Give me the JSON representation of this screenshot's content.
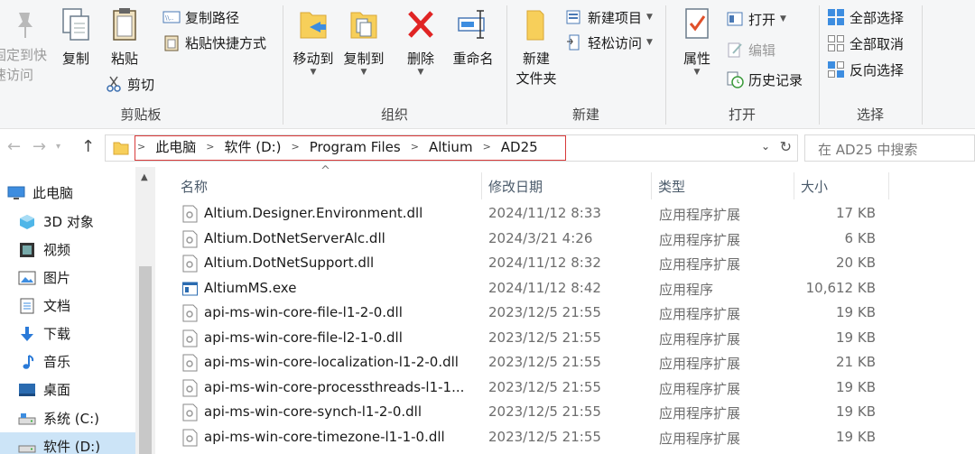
{
  "ribbon": {
    "clipboard": {
      "label": "剪贴板",
      "pin_label_1": "固定到快",
      "pin_label_2": "速访问",
      "copy": "复制",
      "paste": "粘贴",
      "copy_path": "复制路径",
      "paste_shortcut": "粘贴快捷方式",
      "cut": "剪切"
    },
    "organize": {
      "label": "组织",
      "move_to": "移动到",
      "copy_to": "复制到",
      "delete": "删除",
      "rename": "重命名"
    },
    "new": {
      "label": "新建",
      "new_folder_1": "新建",
      "new_folder_2": "文件夹",
      "new_item": "新建项目",
      "easy_access": "轻松访问"
    },
    "open": {
      "label": "打开",
      "properties": "属性",
      "open": "打开",
      "edit": "编辑",
      "history": "历史记录"
    },
    "select": {
      "label": "选择",
      "select_all": "全部选择",
      "select_none": "全部取消",
      "invert": "反向选择"
    }
  },
  "address": {
    "crumbs": [
      "此电脑",
      "软件 (D:)",
      "Program Files",
      "Altium",
      "AD25"
    ],
    "search_placeholder": "在 AD25 中搜索"
  },
  "nav": {
    "items": [
      {
        "label": "此电脑",
        "icon": "pc-icon"
      },
      {
        "label": "3D 对象",
        "icon": "3d-objects-icon"
      },
      {
        "label": "视频",
        "icon": "video-icon"
      },
      {
        "label": "图片",
        "icon": "pictures-icon"
      },
      {
        "label": "文档",
        "icon": "documents-icon"
      },
      {
        "label": "下载",
        "icon": "download-icon"
      },
      {
        "label": "音乐",
        "icon": "music-icon"
      },
      {
        "label": "桌面",
        "icon": "desktop-icon"
      },
      {
        "label": "系统 (C:)",
        "icon": "drive-icon"
      },
      {
        "label": "软件 (D:)",
        "icon": "drive-icon"
      }
    ]
  },
  "columns": {
    "name": "名称",
    "date": "修改日期",
    "type": "类型",
    "size": "大小"
  },
  "files": [
    {
      "name": "Altium.Designer.Environment.dll",
      "date": "2024/11/12 8:33",
      "type": "应用程序扩展",
      "size": "17 KB",
      "kind": "dll"
    },
    {
      "name": "Altium.DotNetServerAlc.dll",
      "date": "2024/3/21 4:26",
      "type": "应用程序扩展",
      "size": "6 KB",
      "kind": "dll"
    },
    {
      "name": "Altium.DotNetSupport.dll",
      "date": "2024/11/12 8:32",
      "type": "应用程序扩展",
      "size": "20 KB",
      "kind": "dll"
    },
    {
      "name": "AltiumMS.exe",
      "date": "2024/11/12 8:42",
      "type": "应用程序",
      "size": "10,612 KB",
      "kind": "exe"
    },
    {
      "name": "api-ms-win-core-file-l1-2-0.dll",
      "date": "2023/12/5 21:55",
      "type": "应用程序扩展",
      "size": "19 KB",
      "kind": "dll"
    },
    {
      "name": "api-ms-win-core-file-l2-1-0.dll",
      "date": "2023/12/5 21:55",
      "type": "应用程序扩展",
      "size": "19 KB",
      "kind": "dll"
    },
    {
      "name": "api-ms-win-core-localization-l1-2-0.dll",
      "date": "2023/12/5 21:55",
      "type": "应用程序扩展",
      "size": "21 KB",
      "kind": "dll"
    },
    {
      "name": "api-ms-win-core-processthreads-l1-1...",
      "date": "2023/12/5 21:55",
      "type": "应用程序扩展",
      "size": "19 KB",
      "kind": "dll"
    },
    {
      "name": "api-ms-win-core-synch-l1-2-0.dll",
      "date": "2023/12/5 21:55",
      "type": "应用程序扩展",
      "size": "19 KB",
      "kind": "dll"
    },
    {
      "name": "api-ms-win-core-timezone-l1-1-0.dll",
      "date": "2023/12/5 21:55",
      "type": "应用程序扩展",
      "size": "19 KB",
      "kind": "dll"
    }
  ],
  "colors": {
    "accent": "#0078d7",
    "highlight_border": "#d83a3a",
    "nav_selected": "#cce4f7"
  }
}
